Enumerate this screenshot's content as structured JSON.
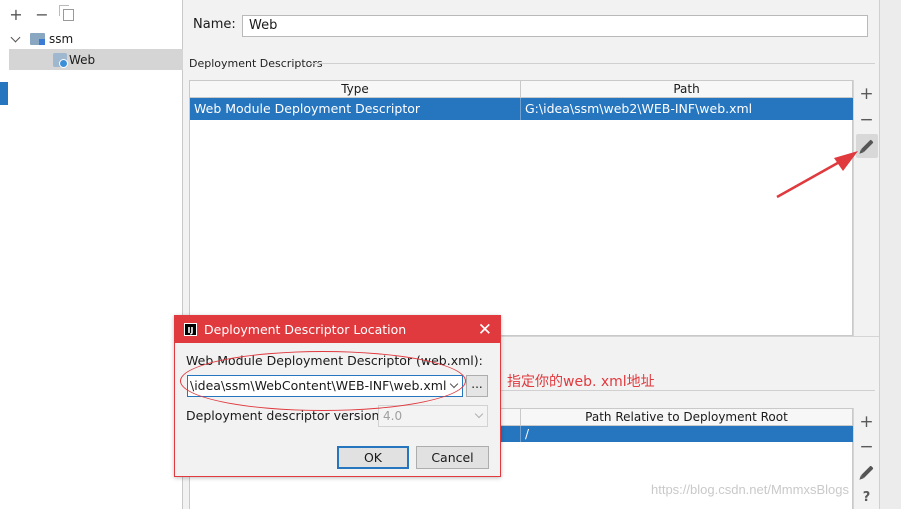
{
  "tree": {
    "toolbar": {
      "add": "+",
      "remove": "−"
    },
    "items": [
      {
        "label": "ssm"
      },
      {
        "label": "Web"
      }
    ]
  },
  "form": {
    "name_label": "Name:",
    "name_value": "Web"
  },
  "deployment_descriptors": {
    "section_title": "Deployment Descriptors",
    "columns": [
      "Type",
      "Path"
    ],
    "rows": [
      {
        "type": "Web Module Deployment Descriptor",
        "path": "G:\\idea\\ssm\\web2\\WEB-INF\\web.xml"
      }
    ]
  },
  "web_resources": {
    "columns": [
      "",
      "Path Relative to Deployment Root"
    ],
    "rows": [
      {
        "dir": "",
        "path": "/"
      }
    ]
  },
  "side_toolbar": {
    "add": "+",
    "remove": "−",
    "help": "?"
  },
  "dialog": {
    "title": "Deployment Descriptor Location",
    "app_icon": "IJ",
    "close": "✕",
    "descriptor_label": "Web Module Deployment Descriptor (web.xml):",
    "descriptor_value": "\\idea\\ssm\\WebContent\\WEB-INF\\web.xml",
    "browse_label": "...",
    "version_label": "Deployment descriptor version",
    "version_value": "4.0",
    "ok_label": "OK",
    "cancel_label": "Cancel"
  },
  "annotation": {
    "text": "指定你的web. xml地址",
    "color": "#e0393e"
  },
  "watermark": "https://blog.csdn.net/MmmxsBlogs",
  "colors": {
    "selection": "#2675bf",
    "dialog_accent": "#e0393e"
  }
}
